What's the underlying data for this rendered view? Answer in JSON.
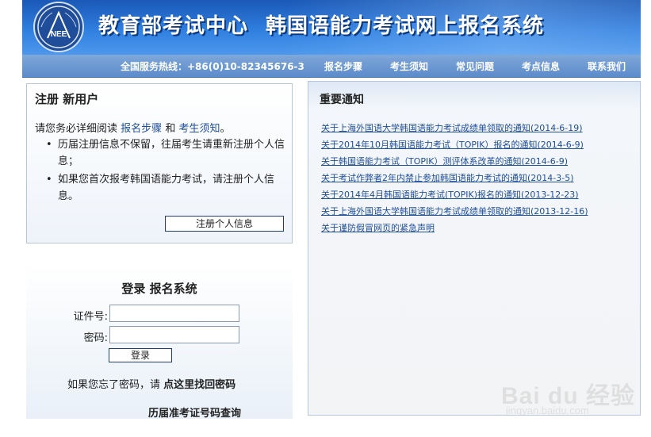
{
  "header": {
    "logo_text": "NEE",
    "title_left": "教育部考试中心",
    "title_right": "韩国语能力考试网上报名系统"
  },
  "nav": {
    "hotline": "全国服务热线：+86(0)10-82345676-3",
    "items": [
      "报名步骤",
      "考生须知",
      "常见问题",
      "考点信息",
      "联系我们"
    ]
  },
  "register": {
    "title": "注册 新用户",
    "intro_prefix": "请您务必详细阅读",
    "link_steps": "报名步骤",
    "intro_and": "和",
    "link_notice": "考生须知",
    "intro_end": "。",
    "bullets": [
      "历届注册信息不保留，往届考生请重新注册个人信息；",
      "如果您首次报考韩国语能力考试，请注册个人信息。"
    ],
    "button": "注册个人信息"
  },
  "login": {
    "title": "登录 报名系统",
    "id_label": "证件号:",
    "password_label": "密码:",
    "id_value": "",
    "password_value": "",
    "button": "登录",
    "forgot_prefix": "如果您忘了密码，请",
    "forgot_link": "点这里找回密码",
    "history_link": "历届准考证号码查询"
  },
  "notices": {
    "title": "重要通知",
    "items": [
      "关于上海外国语大学韩国语能力考试成绩单领取的通知(2014-6-19)",
      "关于2014年10月韩国语能力考试（TOPIK）报名的通知(2014-6-9)",
      "关于韩国语能力考试（TOPIK）测评体系改革的通知(2014-6-9)",
      "关于考试作弊者2年内禁止参加韩国语能力考试的通知(2014-3-5)",
      "关于2014年4月韩国语能力考试(TOPIK)报名的通知(2013-12-23)",
      "关于上海外国语大学韩国语能力考试成绩单领取的通知(2013-12-16)",
      "关于谨防假冒网页的紧急声明"
    ]
  },
  "watermark": {
    "main": "Bai du 经验",
    "sub": "jingyan.baidu.com"
  }
}
